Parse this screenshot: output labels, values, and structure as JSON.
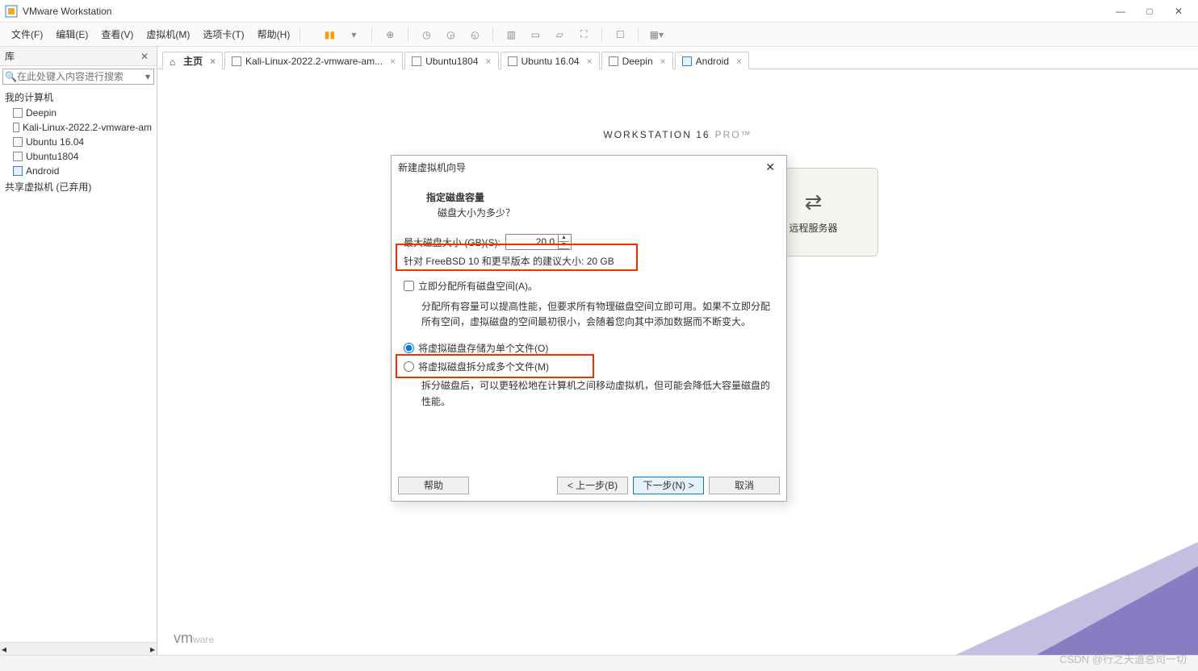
{
  "window": {
    "title": "VMware Workstation"
  },
  "menu": {
    "items": [
      "文件(F)",
      "编辑(E)",
      "查看(V)",
      "虚拟机(M)",
      "选项卡(T)",
      "帮助(H)"
    ]
  },
  "sidebar": {
    "title": "库",
    "search_placeholder": "在此处键入内容进行搜索",
    "root": "我的计算机",
    "items": [
      "Deepin",
      "Kali-Linux-2022.2-vmware-am",
      "Ubuntu 16.04",
      "Ubuntu1804",
      "Android"
    ],
    "shared": "共享虚拟机 (已弃用)"
  },
  "tabs": {
    "home": "主页",
    "items": [
      "Kali-Linux-2022.2-vmware-am...",
      "Ubuntu1804",
      "Ubuntu 16.04",
      "Deepin",
      "Android"
    ]
  },
  "brand": {
    "name": "WORKSTATION 16",
    "edition": "PRO™"
  },
  "card": {
    "remote": "远程服务器"
  },
  "dialog": {
    "title": "新建虚拟机向导",
    "section_title": "指定磁盘容量",
    "section_sub": "磁盘大小为多少？",
    "max_label": "最大磁盘大小 (GB)(S):",
    "max_value": "20.0",
    "recommend": "针对 FreeBSD 10 和更早版本 的建议大小: 20 GB",
    "alloc_now": "立即分配所有磁盘空间(A)。",
    "alloc_desc": "分配所有容量可以提高性能，但要求所有物理磁盘空间立即可用。如果不立即分配所有空间，虚拟磁盘的空间最初很小，会随着您向其中添加数据而不断变大。",
    "radio_single": "将虚拟磁盘存储为单个文件(O)",
    "radio_split": "将虚拟磁盘拆分成多个文件(M)",
    "split_desc": "拆分磁盘后，可以更轻松地在计算机之间移动虚拟机，但可能会降低大容量磁盘的性能。",
    "help": "帮助",
    "back": "< 上一步(B)",
    "next": "下一步(N) >",
    "cancel": "取消"
  },
  "footer": {
    "vmware": "vmware",
    "watermark": "CSDN @行之天道总司一切"
  }
}
